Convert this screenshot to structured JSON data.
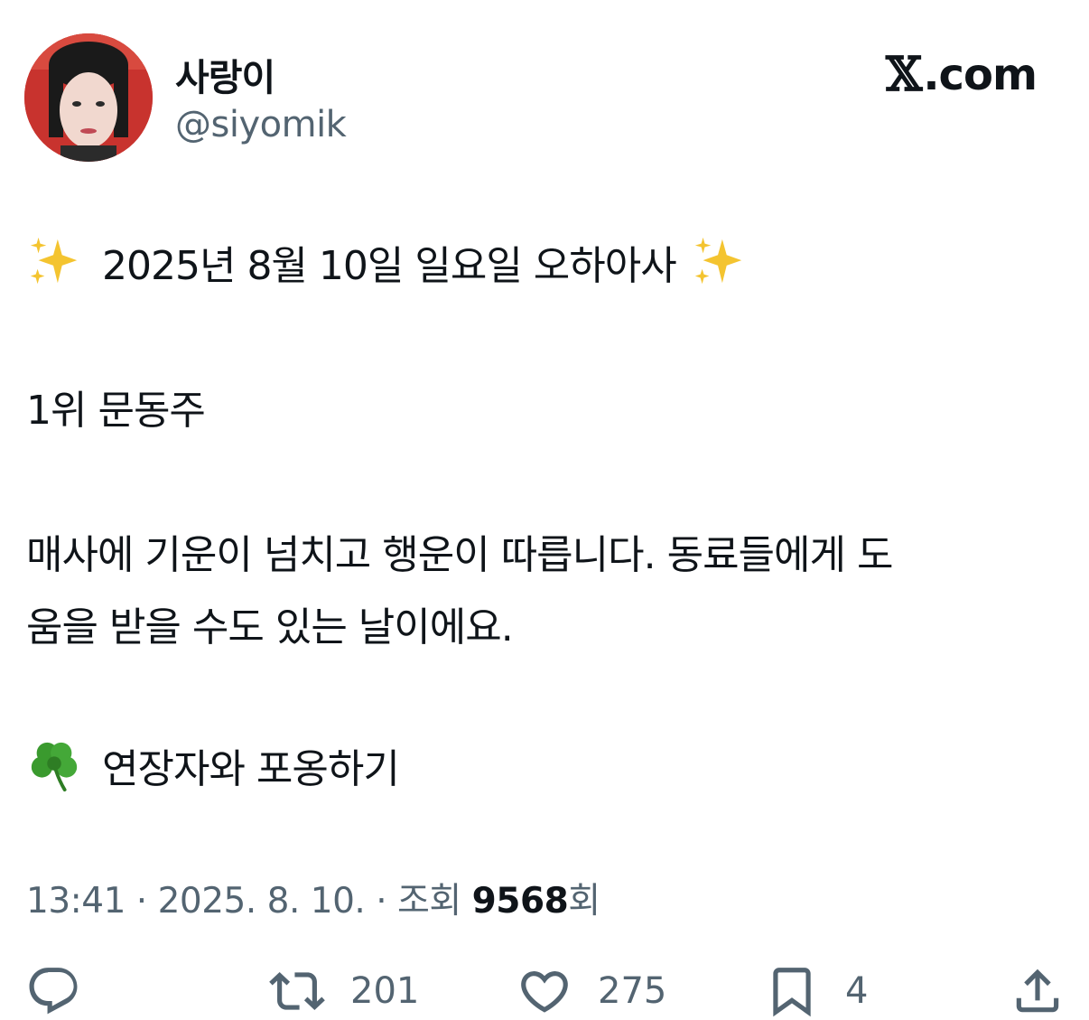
{
  "user": {
    "display_name": "사랑이",
    "handle": "@siyomik"
  },
  "brand": {
    "x_mark": "𝕏",
    "text": ".com"
  },
  "tweet": {
    "line1": "2025년 8월 10일 일요일 오하아사",
    "line2": "1위 문동주",
    "line3": "매사에 기운이 넘치고 행운이 따릅니다. 동료들에게 도",
    "line4": "움을 받을 수도 있는 날이에요.",
    "line5": "연장자와 포옹하기",
    "emojis": [
      "sparkles-icon",
      "four-leaf-clover-icon"
    ]
  },
  "meta": {
    "time": "13:41",
    "sep1": " · ",
    "date": "2025. 8. 10.",
    "sep2": " · ",
    "views_label": "조회 ",
    "views_count": "9568",
    "views_suffix": "회"
  },
  "actions": {
    "reply_icon": "reply-icon",
    "retweet_count": "201",
    "like_count": "275",
    "bookmark_count": "4",
    "share_icon": "share-icon"
  },
  "colors": {
    "text": "#0f1419",
    "secondary": "#536471",
    "sparkle": "#f4c430",
    "clover": "#3a9a2e"
  }
}
